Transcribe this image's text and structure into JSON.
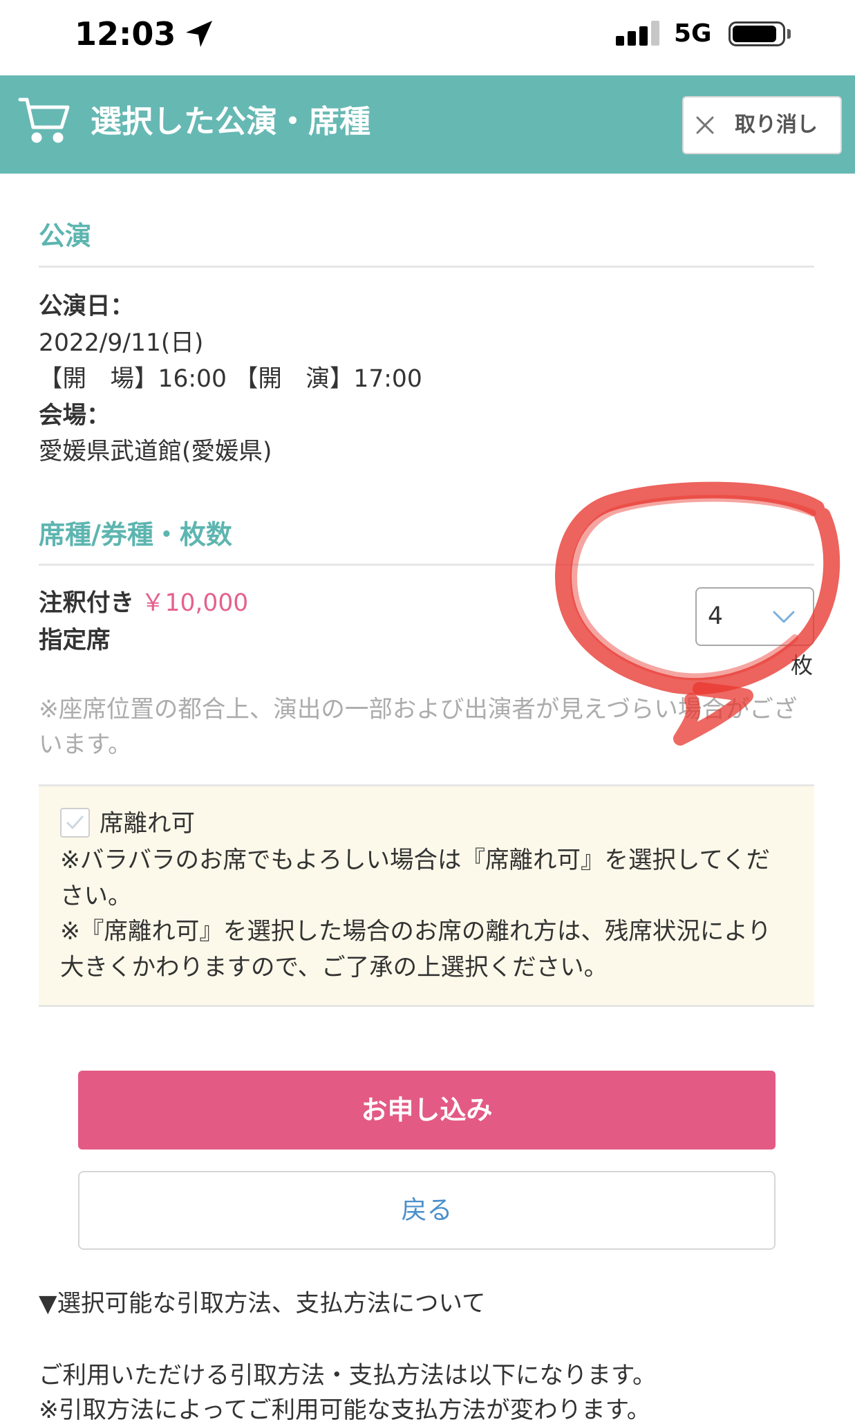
{
  "status_bar": {
    "time": "12:03",
    "network": "5G",
    "signal_bars": 3,
    "battery_level": 0.9
  },
  "header": {
    "title": "選択した公演・席種",
    "cancel_label": "取り消し"
  },
  "performance": {
    "heading": "公演",
    "date_label": "公演日：",
    "date": "2022/9/11(日)",
    "times": "【開　場】16:00 【開　演】17:00",
    "venue_label": "会場：",
    "venue": "愛媛県武道館(愛媛県)"
  },
  "seat": {
    "heading": "席種/券種・枚数",
    "type": "注釈付き",
    "price": "￥10,000",
    "seat_class": "指定席",
    "quantity": "4",
    "quantity_unit": "枚",
    "note": "※座席位置の都合上、演出の一部および出演者が見えづらい場合がございます。"
  },
  "separate_seats": {
    "label": "席離れ可",
    "note_1": "※バラバラのお席でもよろしい場合は『席離れ可』を選択してください。",
    "note_2": "※『席離れ可』を選択した場合のお席の離れ方は、残席状況により大きくかわりますので、ご了承の上選択ください。"
  },
  "actions": {
    "apply_label": "お申し込み",
    "back_label": "戻る"
  },
  "methods": {
    "toggle": "▼選択可能な引取方法、支払方法について",
    "intro": "ご利用いただける引取方法・支払方法は以下になります。",
    "note": "※引取方法によってご利用可能な支払方法が変わります。"
  },
  "icons": {
    "location": "location-arrow-icon",
    "signal": "signal-icon",
    "battery": "battery-icon",
    "cart": "cart-icon",
    "close": "close-icon",
    "chevron": "chevron-down-icon",
    "check": "check-icon"
  },
  "colors": {
    "header_bg": "#66b8b3",
    "heading": "#5db5b0",
    "price": "#e3628c",
    "primary": "#e35a84",
    "link": "#4a8fca",
    "notice_bg": "#fdf9ea",
    "annotation": "#e8372f"
  }
}
